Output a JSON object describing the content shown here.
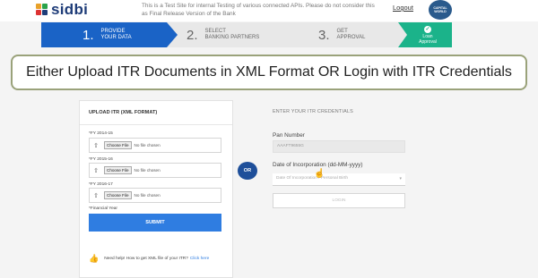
{
  "header": {
    "logo_text": "sidbi",
    "logo_colors": [
      "#1e3c78",
      "#e8a12a",
      "#2aa24a",
      "#d33"
    ],
    "notice": "This is a Test Site for internal Testing of various connected APIs. Please do not consider this as Final Release Version of the Bank",
    "logout": "Logout",
    "badge_text": "CAPITAL WORLD"
  },
  "stepper": {
    "steps": [
      {
        "num": "1.",
        "label_line1": "PROVIDE",
        "label_line2": "YOUR DATA",
        "state": "active"
      },
      {
        "num": "2.",
        "label_line1": "SELECT",
        "label_line2": "BANKING PARTNERS",
        "state": "pending"
      },
      {
        "num": "3.",
        "label_line1": "GET",
        "label_line2": "APPROVAL",
        "state": "pending"
      },
      {
        "num": "",
        "label_line1": "Loan",
        "label_line2": "Approval",
        "state": "done"
      }
    ],
    "colors": {
      "active": "#1a63c6",
      "done": "#1bb38a"
    }
  },
  "banner": {
    "text": "Either Upload ITR Documents in XML Format OR Login with ITR Credentials"
  },
  "upload_panel": {
    "title": "UPLOAD ITR (XML FORMAT)",
    "years": [
      {
        "label": "*FY 2014-15",
        "button": "Choose File",
        "status": "No file chosen"
      },
      {
        "label": "*FY 2015-16",
        "button": "Choose File",
        "status": "No file chosen"
      },
      {
        "label": "*FY 2016-17",
        "button": "Choose File",
        "status": "No file chosen"
      }
    ],
    "footnote": "*Financial Year",
    "submit": "SUBMIT",
    "help_text": "Need help! How to get XML file of your ITR?",
    "help_link": "Click here"
  },
  "or_label": "OR",
  "credentials_panel": {
    "title": "ENTER YOUR ITR CREDENTIALS",
    "pan_label": "Pan Number",
    "pan_value": "AAAFT9655G",
    "doi_label": "Date of Incorporation (dd-MM-yyyy)",
    "doi_placeholder": "Date Of Incorporation / Personal Birth",
    "login": "LOGIN"
  }
}
